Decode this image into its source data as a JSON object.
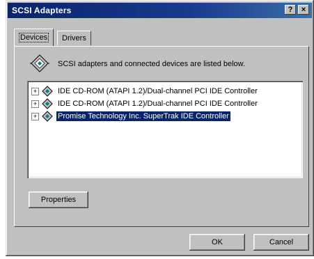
{
  "window": {
    "title": "SCSI Adapters",
    "help_button": "?",
    "close_button": "×"
  },
  "tabs": [
    {
      "label": "Devices",
      "active": true
    },
    {
      "label": "Drivers",
      "active": false
    }
  ],
  "description": "SCSI adapters and connected devices are listed below.",
  "tree": {
    "items": [
      {
        "label": "IDE CD-ROM (ATAPI 1.2)/Dual-channel PCI IDE Controller",
        "expander": "+",
        "selected": false
      },
      {
        "label": "IDE CD-ROM (ATAPI 1.2)/Dual-channel PCI IDE Controller",
        "expander": "+",
        "selected": false
      },
      {
        "label": "Promise Technology Inc. SuperTrak IDE Controller",
        "expander": "+",
        "selected": true
      }
    ]
  },
  "buttons": {
    "properties": "Properties",
    "ok": "OK",
    "cancel": "Cancel"
  },
  "colors": {
    "titlebar": "#0a246a",
    "face": "#c0c0c0",
    "selection": "#0a246a"
  }
}
